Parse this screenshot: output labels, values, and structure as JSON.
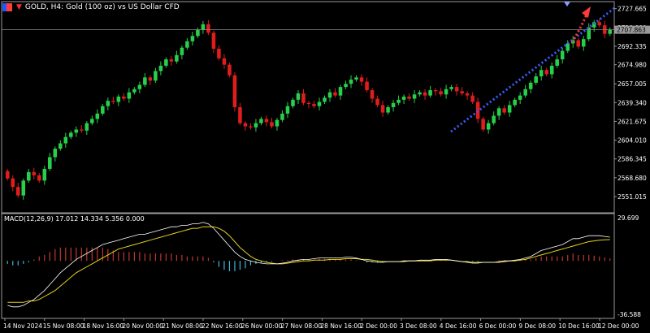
{
  "header": {
    "symbol_title": "GOLD, H4:  Gold (100 oz) vs US Dollar CFD"
  },
  "macd": {
    "label": "MACD(12,26,9) 17.012 14.334 5.356 0.000",
    "scale_top": "29.699",
    "scale_bottom": "-36.588"
  },
  "colors": {
    "background": "#000000",
    "bull_candle": "#26d04a",
    "bear_candle": "#e01d1d",
    "macd_main": "#ffffff",
    "macd_signal": "#e8d21a",
    "hist_pos": "#c0392b",
    "hist_neg": "#3fb6d8",
    "trendline": "#3b5bff",
    "arrow": "#ff3b3b"
  },
  "chart_data": [
    {
      "type": "candlestick",
      "title": "GOLD, H4:  Gold (100 oz) vs US Dollar CFD",
      "y_ticks": [
        "2727.665",
        "2710.000",
        "2692.335",
        "2674.980",
        "2657.005",
        "2639.340",
        "2621.675",
        "2604.010",
        "2586.345",
        "2568.680",
        "2551.015"
      ],
      "current_price_label": "2707.863",
      "ylim": [
        2538,
        2732
      ],
      "x_tick_labels": [
        "14 Nov 2024",
        "15 Nov 08:00",
        "18 Nov 16:00",
        "20 Nov 00:00",
        "21 Nov 08:00",
        "22 Nov 16:00",
        "26 Nov 00:00",
        "27 Nov 08:00",
        "28 Nov 16:00",
        "2 Dec 00:00",
        "3 Dec 08:00",
        "4 Dec 16:00",
        "6 Dec 00:00",
        "9 Dec 08:00",
        "10 Dec 16:00",
        "12 Dec 00:00"
      ],
      "close": [
        2568,
        2560,
        2552,
        2566,
        2574,
        2571,
        2566,
        2577,
        2588,
        2596,
        2601,
        2607,
        2611,
        2614,
        2613,
        2620,
        2624,
        2629,
        2636,
        2641,
        2640,
        2645,
        2643,
        2649,
        2652,
        2656,
        2663,
        2660,
        2669,
        2674,
        2680,
        2678,
        2684,
        2691,
        2697,
        2702,
        2708,
        2713,
        2705,
        2690,
        2681,
        2675,
        2665,
        2635,
        2620,
        2617,
        2616,
        2620,
        2624,
        2621,
        2617,
        2623,
        2629,
        2636,
        2642,
        2648,
        2639,
        2638,
        2636,
        2640,
        2644,
        2649,
        2646,
        2654,
        2657,
        2661,
        2663,
        2659,
        2651,
        2643,
        2637,
        2630,
        2635,
        2639,
        2642,
        2645,
        2643,
        2647,
        2649,
        2646,
        2651,
        2650,
        2647,
        2652,
        2654,
        2650,
        2648,
        2646,
        2640,
        2624,
        2614,
        2620,
        2627,
        2634,
        2630,
        2637,
        2642,
        2646,
        2652,
        2658,
        2664,
        2670,
        2666,
        2674,
        2680,
        2688,
        2695,
        2698,
        2692,
        2699,
        2710,
        2715,
        2712,
        2704,
        2708
      ],
      "trendline": {
        "from_price": 2612,
        "to_price": 2728
      },
      "arrow": "red dotted arrow pointing up-right"
    },
    {
      "type": "macd",
      "ylim": [
        -36.588,
        29.699
      ],
      "main": [
        -30,
        -31,
        -31,
        -30,
        -28,
        -26,
        -23,
        -20,
        -16,
        -12,
        -8,
        -5,
        -2,
        1,
        3,
        5,
        7,
        9,
        11,
        12,
        13,
        14,
        15,
        16,
        17,
        18,
        18,
        19,
        20,
        21,
        22,
        23,
        23,
        24,
        24,
        25,
        25,
        26,
        25,
        22,
        18,
        14,
        10,
        6,
        3,
        1,
        0,
        -1,
        -1.5,
        -2,
        -2,
        -2,
        -1.5,
        -1,
        0,
        0.5,
        1,
        1,
        1.5,
        2,
        2,
        2,
        2,
        2,
        2.5,
        2.5,
        2,
        1,
        0,
        -0.5,
        -1,
        -1,
        -0.5,
        -0.5,
        -0.5,
        0,
        0,
        0,
        0.5,
        0.5,
        0.5,
        1,
        1,
        1,
        0.5,
        0,
        -0.5,
        -1,
        -1.5,
        -1.5,
        -1,
        -1,
        -1,
        -0.5,
        0,
        0,
        0.5,
        1,
        2,
        3,
        5,
        7,
        8,
        9,
        10,
        11,
        13,
        15,
        15,
        16,
        17,
        17.012,
        17,
        16.5,
        16
      ],
      "signal": [
        -28,
        -28,
        -28,
        -28,
        -27,
        -27,
        -26,
        -24,
        -22,
        -20,
        -17,
        -14,
        -11,
        -8,
        -6,
        -4,
        -2,
        0,
        2,
        4,
        6,
        8,
        9,
        10,
        11,
        12,
        13,
        14,
        15,
        16,
        17,
        18,
        19,
        20,
        21,
        22,
        22,
        23,
        23,
        23,
        22,
        20,
        17,
        13,
        9,
        6,
        3,
        1,
        0,
        -1,
        -1.5,
        -2,
        -2,
        -1.5,
        -1,
        -0.5,
        0,
        0,
        0.5,
        0.5,
        0.5,
        1,
        1,
        1,
        1.5,
        1.5,
        1.5,
        1,
        1,
        0.5,
        0,
        -0.5,
        -0.5,
        -0.5,
        -0.5,
        -0.5,
        0,
        0,
        0,
        0,
        0,
        0.5,
        0.5,
        0.5,
        0.5,
        0,
        -0.5,
        -0.5,
        -1,
        -1,
        -1,
        -1,
        -1,
        -1,
        -0.5,
        0,
        0,
        0.5,
        1,
        2,
        3,
        4,
        5,
        6,
        7,
        8,
        9,
        10,
        11,
        12,
        13,
        13.5,
        14,
        14.2,
        14.334
      ]
    }
  ]
}
